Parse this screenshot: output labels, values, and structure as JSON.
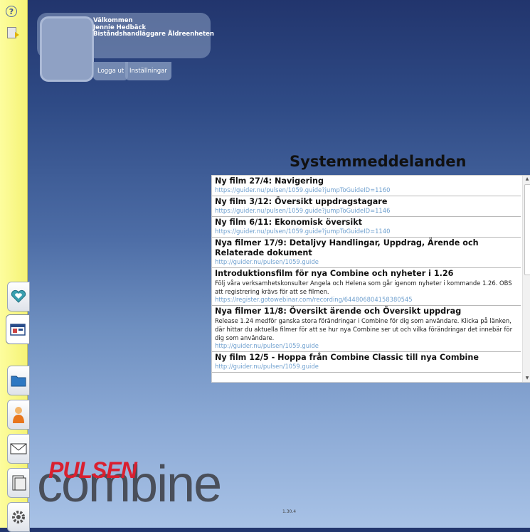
{
  "sidebar": {
    "help_icon": "?",
    "buttons": [
      "heart-icon",
      "calendar-icon",
      "folder-icon",
      "person-icon",
      "envelope-icon",
      "document-icon",
      "gear-icon"
    ]
  },
  "welcome": {
    "greeting": "Välkommen",
    "name": "Jennie Hedbäck",
    "role": "Biståndshandläggare Äldreenheten",
    "logout_label": "Logga ut",
    "settings_label": "Inställningar"
  },
  "system_messages": {
    "title": "Systemmeddelanden",
    "items": [
      {
        "title": "Ny film 27/4: Navigering",
        "body": "",
        "link": "https://guider.nu/pulsen/1059.guide?jumpToGuideID=1160"
      },
      {
        "title": "Ny film 3/12: Översikt uppdragstagare",
        "body": "",
        "link": "https://guider.nu/pulsen/1059.guide?jumpToGuideID=1146"
      },
      {
        "title": "Ny film 6/11: Ekonomisk översikt",
        "body": "",
        "link": "https://guider.nu/pulsen/1059.guide?jumpToGuideID=1140"
      },
      {
        "title": "Nya filmer 17/9: Detaljvy Handlingar, Uppdrag, Ärende och Relaterade dokument",
        "body": "",
        "link": "http://guider.nu/pulsen/1059.guide"
      },
      {
        "title": "Introduktionsfilm för nya Combine och nyheter i 1.26",
        "body": "Följ våra verksamhetskonsulter Angela och Helena som går igenom nyheter i kommande 1.26. OBS att registrering krävs för att se filmen.",
        "link": "https://register.gotowebinar.com/recording/644806804158380545"
      },
      {
        "title": "Nya filmer 11/8: Översikt ärende och Översikt uppdrag",
        "body": "Release 1.24 medför ganska stora förändringar i Combine för dig som användare. Klicka på länken, där hittar du aktuella filmer för att se hur nya Combine ser ut och vilka förändringar det innebär för dig som användare.",
        "link": "http://guider.nu/pulsen/1059.guide"
      },
      {
        "title": "Ny film 12/5 - Hoppa från Combine Classic till nya Combine",
        "body": "",
        "link": "http://guider.nu/pulsen/1059.guide"
      }
    ]
  },
  "logo": {
    "brand": "PULSEN",
    "product": "combine",
    "version": "1.30.4"
  },
  "colors": {
    "sidebar": "#f5f376",
    "accent_red": "#d92030",
    "link": "#6fa0cf"
  }
}
